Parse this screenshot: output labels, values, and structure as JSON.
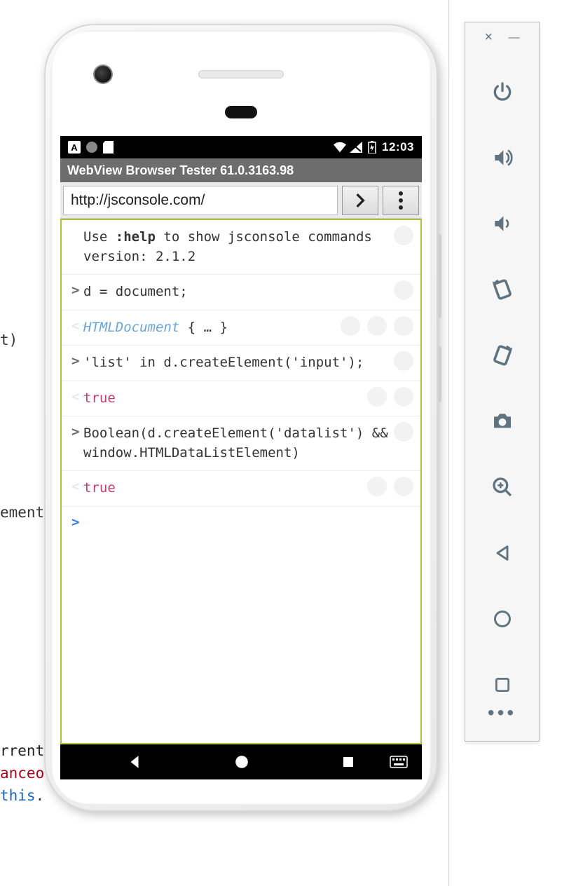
{
  "background_text": {
    "t_paren": "t)",
    "ement": "ement",
    "rrent": "rrent",
    "anceo": "anceo",
    "this": "this",
    "dot": "."
  },
  "status": {
    "icon_a": "A",
    "time": "12:03"
  },
  "app": {
    "title": "WebView Browser Tester 61.0.3163.98"
  },
  "url_bar": {
    "url": "http://jsconsole.com/"
  },
  "console": {
    "intro_line1_pre": "Use ",
    "intro_help": ":help",
    "intro_line1_post": " to show jsconsole commands",
    "intro_line2": "version: 2.1.2",
    "in1": "d = document;",
    "out1_type": "HTMLDocument",
    "out1_rest": " { … }",
    "in2": "'list' in d.createElement('input');",
    "out2": "true",
    "in3": "Boolean(d.createElement('datalist') && window.HTMLDataListElement)",
    "out3": "true",
    "prompt_in": ">",
    "prompt_out": "<·",
    "prompt_active": ">"
  },
  "emu": {
    "close": "×",
    "minimize": "—"
  }
}
